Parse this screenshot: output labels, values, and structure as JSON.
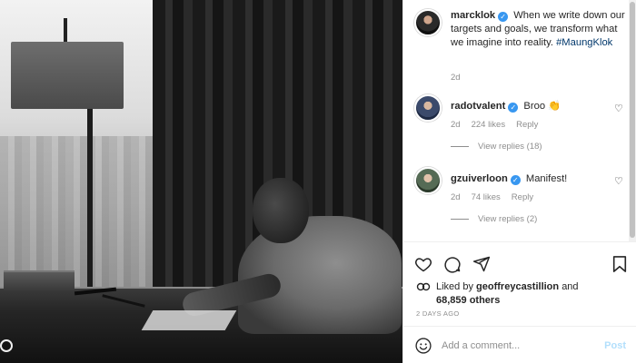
{
  "post": {
    "author": "marcklok",
    "caption": "When we write down our targets and goals, we transform what we imagine into reality.",
    "hashtag": "#MaungKlok",
    "age": "2d"
  },
  "comments": [
    {
      "user": "radotvalent",
      "text": "Broo",
      "emoji": "👏",
      "age": "2d",
      "likes": "224 likes",
      "reply": "Reply",
      "view_replies": "View replies (18)"
    },
    {
      "user": "gzuiverloon",
      "text": "Manifest!",
      "age": "2d",
      "likes": "74 likes",
      "reply": "Reply",
      "view_replies": "View replies (2)"
    }
  ],
  "actions": {
    "icons": [
      "heart-icon",
      "comment-icon",
      "share-icon",
      "bookmark-icon"
    ],
    "liked_prefix": "Liked by",
    "liked_user": "geoffreycastillion",
    "liked_and": "and",
    "liked_count": "68,859 others",
    "posted": "2 DAYS AGO"
  },
  "add_comment": {
    "placeholder": "Add a comment...",
    "post_label": "Post"
  },
  "colors": {
    "verified": "#3897f0",
    "hashtag": "#00376b",
    "muted": "#8e8e8e",
    "post_disabled": "#b2dffc"
  }
}
